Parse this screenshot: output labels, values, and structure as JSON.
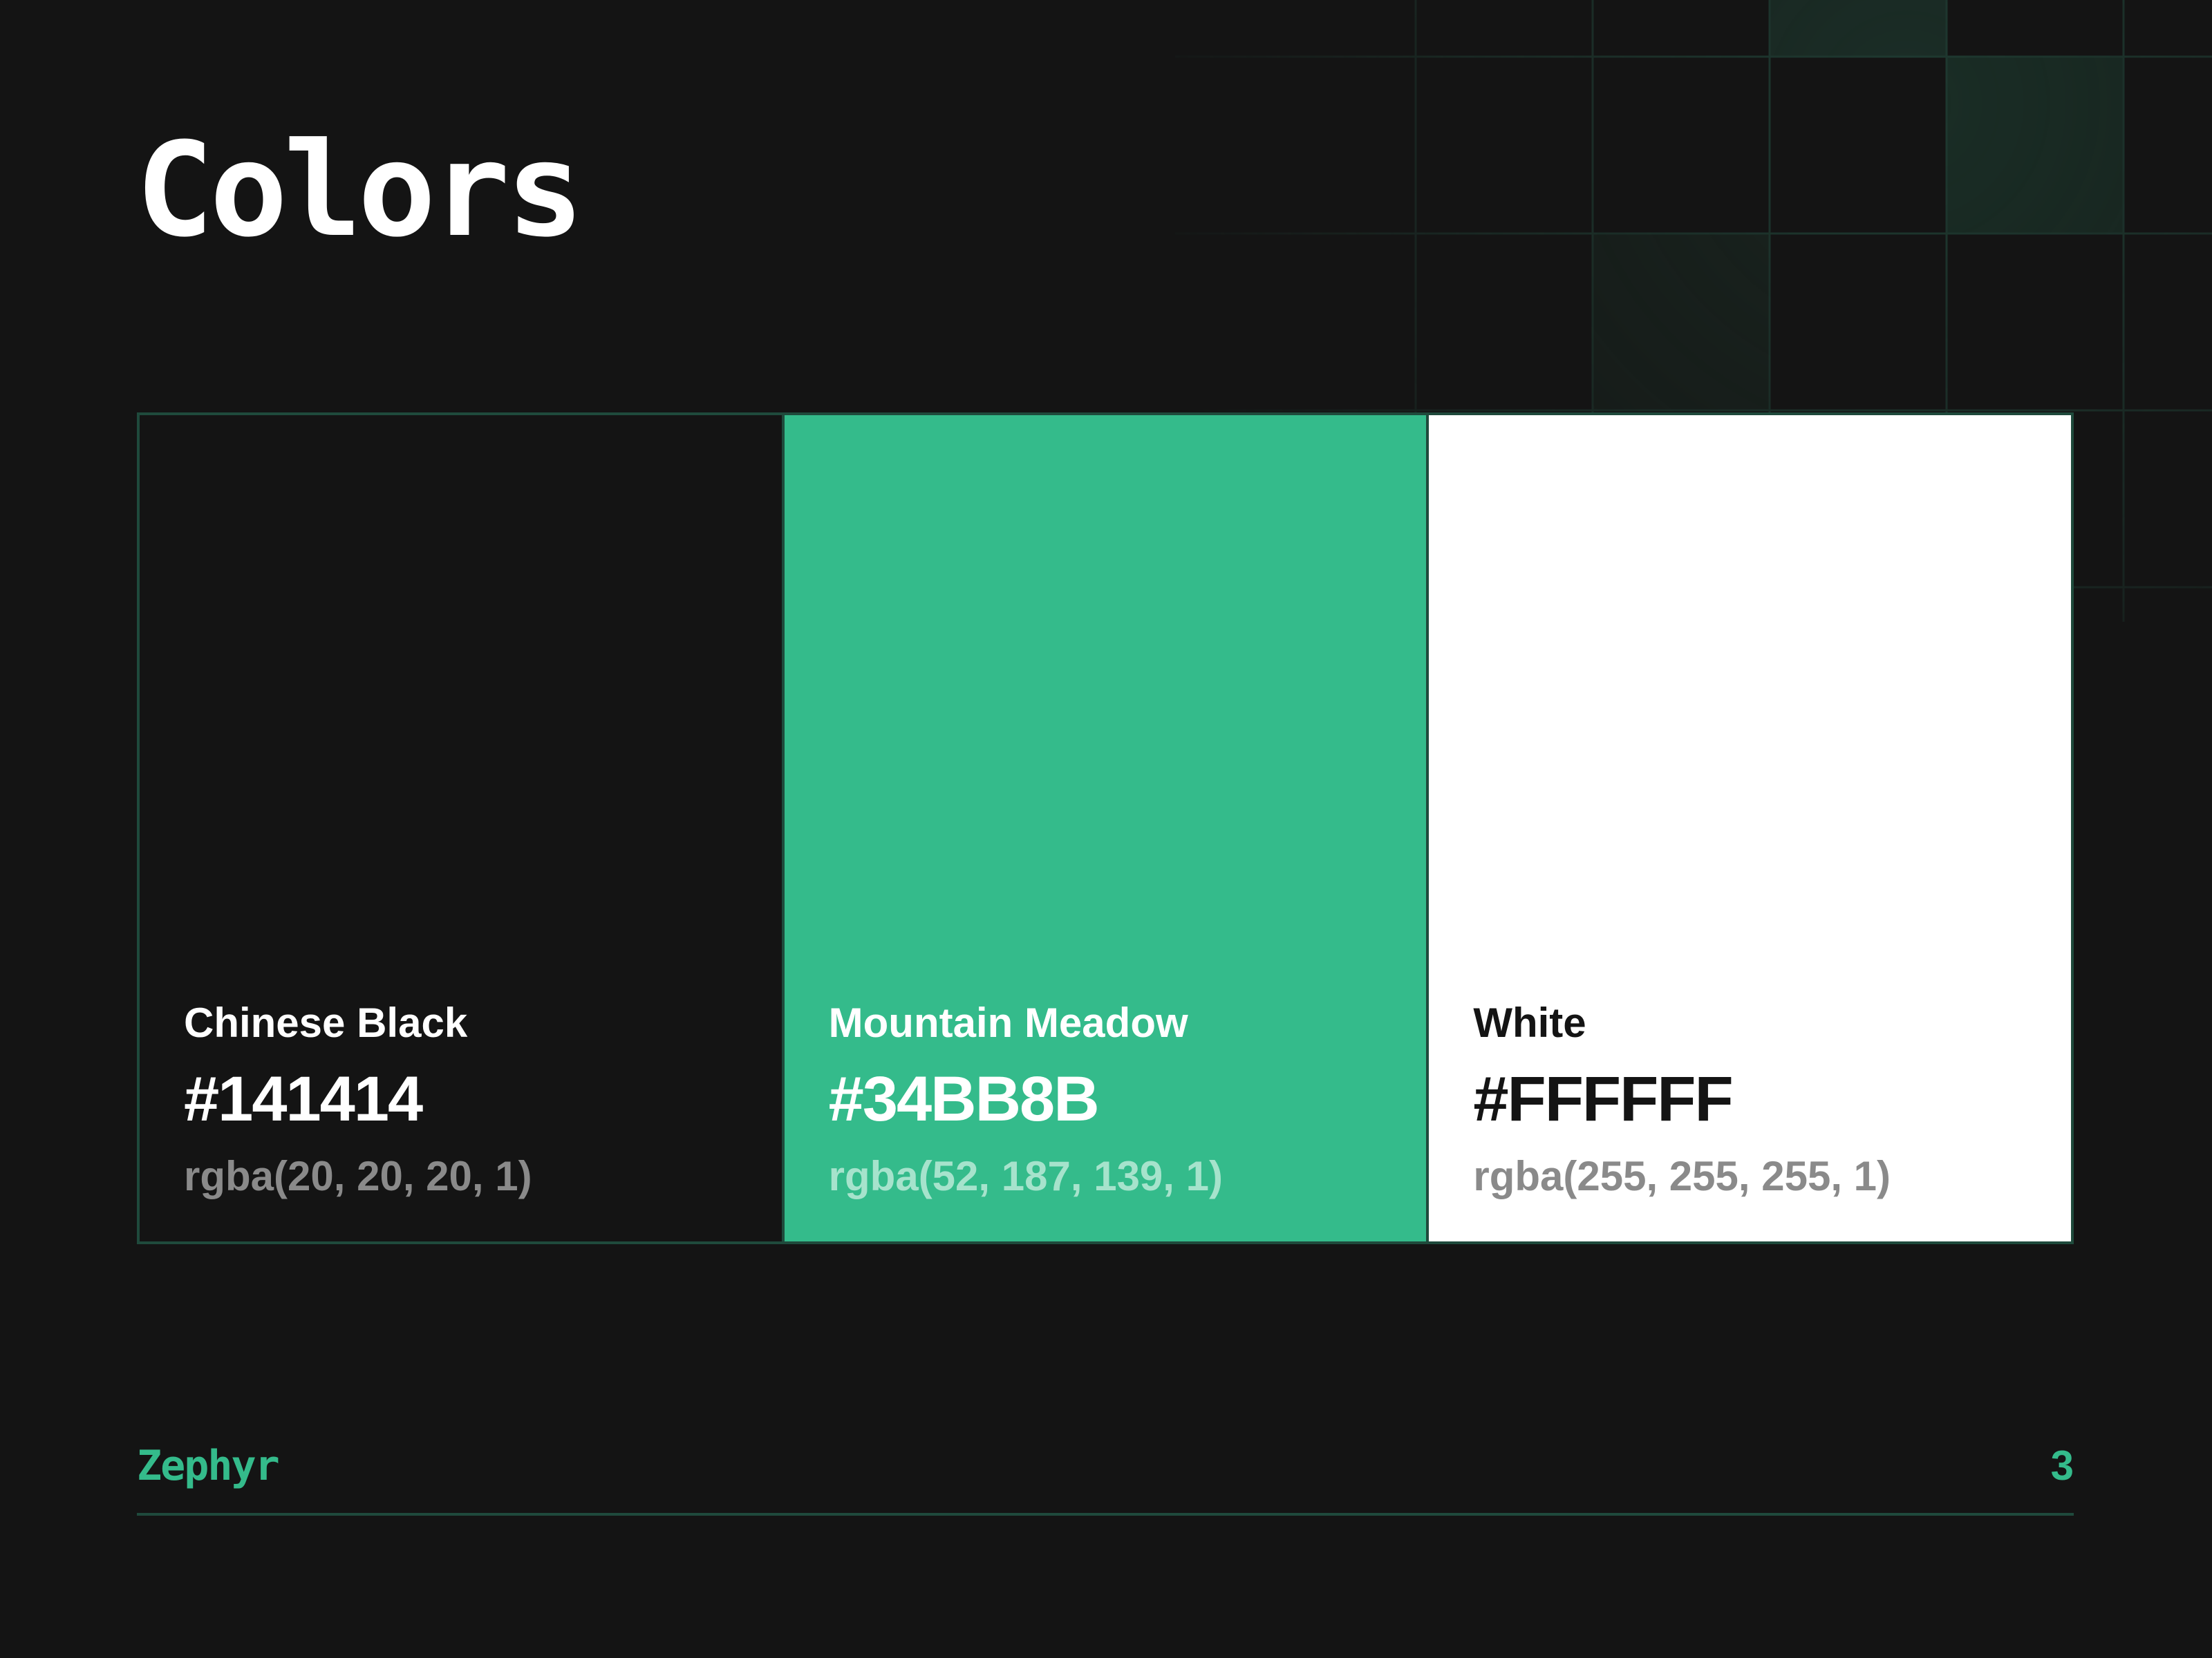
{
  "title": "Colors",
  "swatches": [
    {
      "name": "Chinese Black",
      "hex": "#141414",
      "rgba": "rgba(20, 20, 20, 1)",
      "background": "#141414",
      "name_color": "#FFFFFF",
      "hex_color": "#FFFFFF",
      "rgba_color": "#8A8A8A"
    },
    {
      "name": "Mountain Meadow",
      "hex": "#34BB8B",
      "rgba": "rgba(52, 187, 139, 1)",
      "background": "#34BB8B",
      "name_color": "#FFFFFF",
      "hex_color": "#FFFFFF",
      "rgba_color": "#A6E3CC"
    },
    {
      "name": "White",
      "hex": "#FFFFFF",
      "rgba": "rgba(255, 255, 255, 1)",
      "background": "#FFFFFF",
      "name_color": "#141414",
      "hex_color": "#141414",
      "rgba_color": "#8A8A8A"
    }
  ],
  "footer": {
    "brand": "Zephyr",
    "page_number": "3"
  },
  "theme": {
    "background": "#141414",
    "accent": "#34BB8B",
    "border": "#1F4A3C"
  }
}
